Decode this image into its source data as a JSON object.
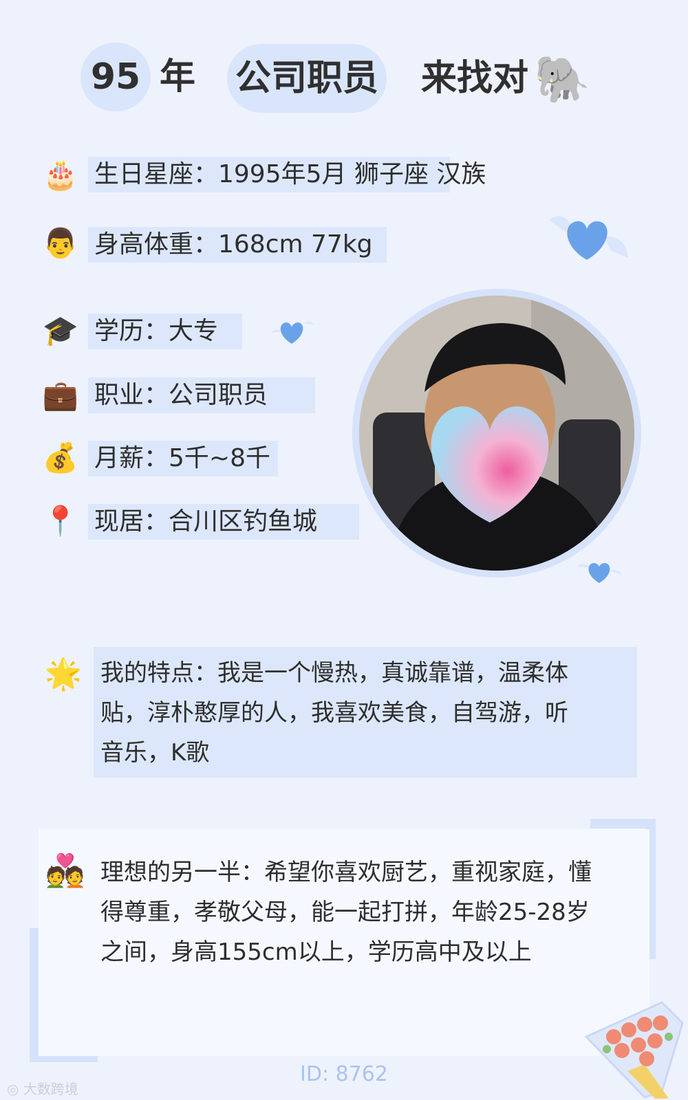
{
  "header": {
    "year_num": "95",
    "year_unit": "年",
    "occupation_tag": "公司职员",
    "looking_text": "来找对",
    "animal_emoji": "🐘"
  },
  "rows": [
    {
      "icon": "🎂",
      "icon_name": "cake-icon",
      "text": "生日星座：1995年5月 狮子座 汉族"
    },
    {
      "icon": "👨",
      "icon_name": "man-face-icon",
      "text": "身高体重：168cm 77kg"
    },
    {
      "icon": "🎓",
      "icon_name": "graduation-cap-icon",
      "text": "学历：大专"
    },
    {
      "icon": "💼",
      "icon_name": "briefcase-icon",
      "text": "职业：公司职员"
    },
    {
      "icon": "💰",
      "icon_name": "money-bag-icon",
      "text": "月薪：5千~8千"
    },
    {
      "icon": "📍",
      "icon_name": "location-pin-icon",
      "text": "现居：合川区钓鱼城"
    }
  ],
  "features": {
    "icon": "🌟",
    "lines": [
      "我的特点：我是一个慢热，真诚靠谱，温柔体",
      "贴，淳朴憨厚的人，我喜欢美食，自驾游，听",
      "音乐，K歌"
    ]
  },
  "ideal": {
    "icon": "💑",
    "lines": [
      "理想的另一半：希望你喜欢厨艺，重视家庭，懂",
      "得尊重，孝敬父母，能一起打拼，年龄25-28岁",
      "之间，身高155cm以上，学历高中及以上"
    ]
  },
  "footer": {
    "id_text": "ID: 8762",
    "watermark": "大数跨境"
  },
  "colors": {
    "background": "#eef2fd",
    "highlight": "#dce7fb",
    "accent_blue": "#6aa2ea"
  }
}
